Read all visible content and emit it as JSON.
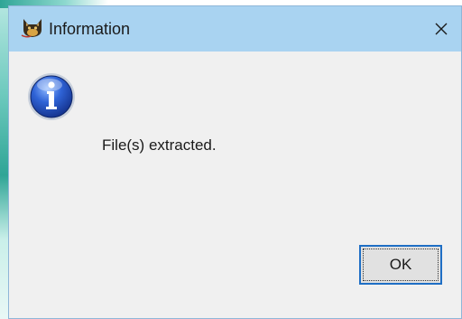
{
  "window": {
    "title": "Information",
    "app_icon": "cat-head-icon",
    "close_icon": "close-icon",
    "titlebar_color": "#a9d3f1"
  },
  "body": {
    "icon": "info-icon",
    "message": "File(s) extracted."
  },
  "buttons": {
    "ok_label": "OK",
    "focus_color": "#1f6fc5"
  }
}
